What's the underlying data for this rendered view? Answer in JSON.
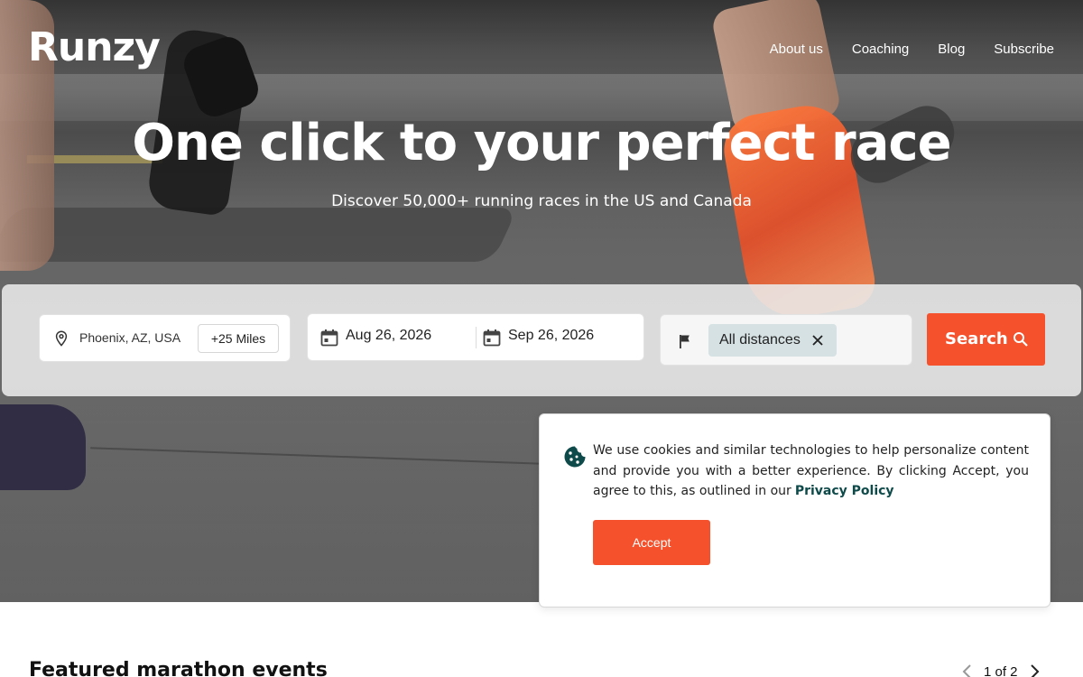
{
  "header": {
    "logo": "Runzy",
    "nav": [
      "About us",
      "Coaching",
      "Blog",
      "Subscribe"
    ]
  },
  "hero": {
    "title": "One click to your perfect race",
    "subtitle": "Discover 50,000+ running races in the US and Canada"
  },
  "search": {
    "location": "Phoenix, AZ, USA",
    "radius": "+25 Miles",
    "date_from": "Aug 26, 2026",
    "date_to": "Sep 26, 2026",
    "distance_chip": "All distances",
    "button": "Search"
  },
  "cookie": {
    "text": "We use cookies and similar technologies to help personalize content and provide you with a better experience. By clicking Accept, you agree to this, as outlined in our",
    "link": "Privacy Policy",
    "accept": "Accept"
  },
  "featured": {
    "title": "Featured marathon events",
    "page": "1 of 2"
  },
  "colors": {
    "accent": "#f4512c",
    "link": "#0f4a4a",
    "chip": "#d6e1e3"
  },
  "icons": [
    "location-pin-icon",
    "calendar-icon",
    "flag-icon",
    "close-icon",
    "search-icon",
    "cookie-icon",
    "chevron-left-icon",
    "chevron-right-icon"
  ]
}
